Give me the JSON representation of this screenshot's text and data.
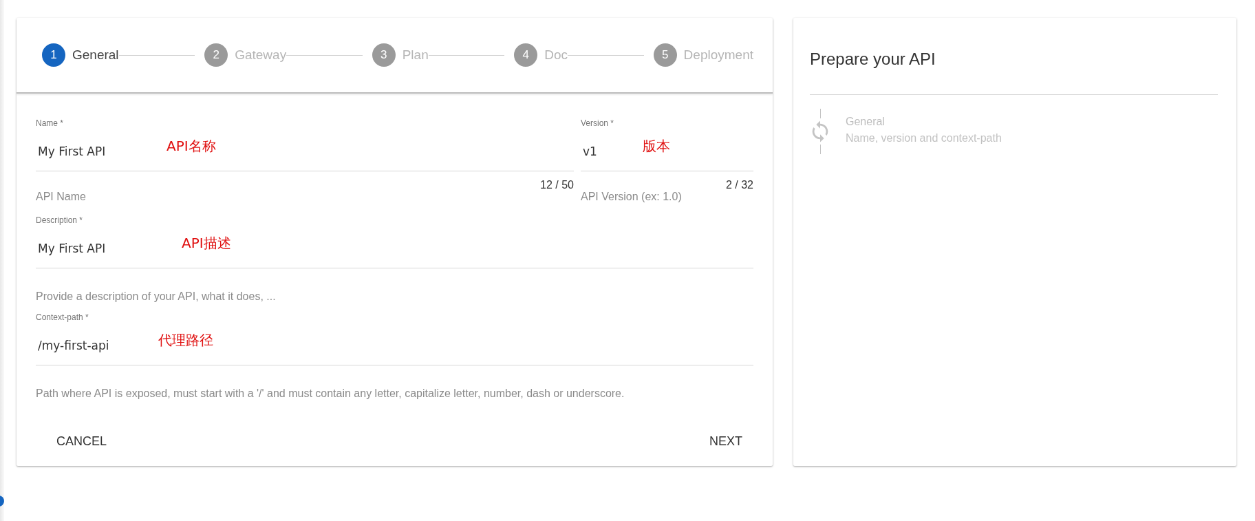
{
  "stepper": [
    {
      "number": "1",
      "label": "General",
      "selected": true
    },
    {
      "number": "2",
      "label": "Gateway",
      "selected": false
    },
    {
      "number": "3",
      "label": "Plan",
      "selected": false
    },
    {
      "number": "4",
      "label": "Doc",
      "selected": false
    },
    {
      "number": "5",
      "label": "Deployment",
      "selected": false
    }
  ],
  "form": {
    "rows": [
      [
        {
          "label": "Name *",
          "value": "My First API",
          "annotation": "API名称",
          "hint": "API Name",
          "counter": "12 / 50"
        },
        {
          "label": "Version *",
          "value": "v1",
          "annotation": "版本",
          "hint": "API Version (ex: 1.0)",
          "counter": "2 / 32"
        }
      ],
      [
        {
          "label": "Description *",
          "value": "My First API",
          "annotation": "API描述",
          "hint": "Provide a description of your API, what it does, ..."
        }
      ],
      [
        {
          "label": "Context-path *",
          "value": "/my-first-api",
          "annotation": "代理路径",
          "hint": "Path where API is exposed, must start with a '/' and must contain any letter, capitalize letter, number, dash or underscore."
        }
      ]
    ],
    "buttons": [
      {
        "label": "CANCEL"
      },
      {
        "label": "NEXT"
      }
    ]
  },
  "summary": {
    "title": "Prepare your API",
    "steps": [
      {
        "title": "General",
        "subtitle": "Name, version and context-path"
      }
    ]
  }
}
